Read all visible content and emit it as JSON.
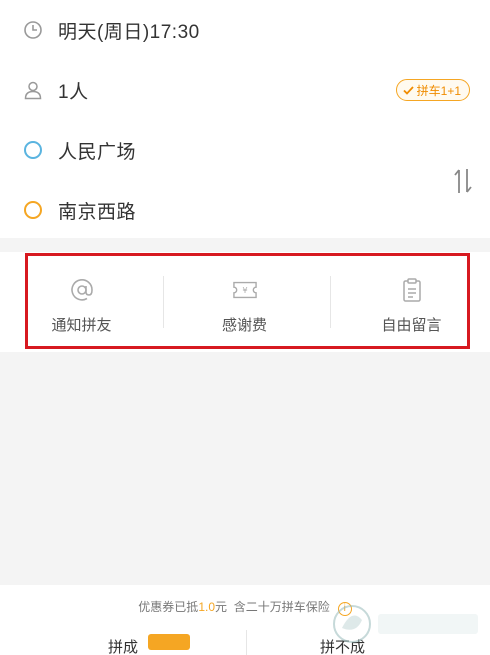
{
  "trip": {
    "time": "明天(周日)17:30",
    "people": "1人",
    "carpool_badge": "拼车1+1",
    "start": "人民广场",
    "end": "南京西路"
  },
  "options": [
    {
      "label": "通知拼友",
      "icon": "at-icon"
    },
    {
      "label": "感谢费",
      "icon": "ticket-icon"
    },
    {
      "label": "自由留言",
      "icon": "clipboard-icon"
    }
  ],
  "footer": {
    "coupon_prefix": "优惠券已抵",
    "coupon_amount": "1.0",
    "coupon_unit": "元",
    "insurance": "含二十万拼车保险",
    "info_icon": "i",
    "left_button": "拼成",
    "right_button": "拼不成"
  },
  "colors": {
    "accent": "#f5a623",
    "start_dot": "#5ab4e0",
    "end_dot": "#f5a623",
    "highlight": "#d71920"
  }
}
